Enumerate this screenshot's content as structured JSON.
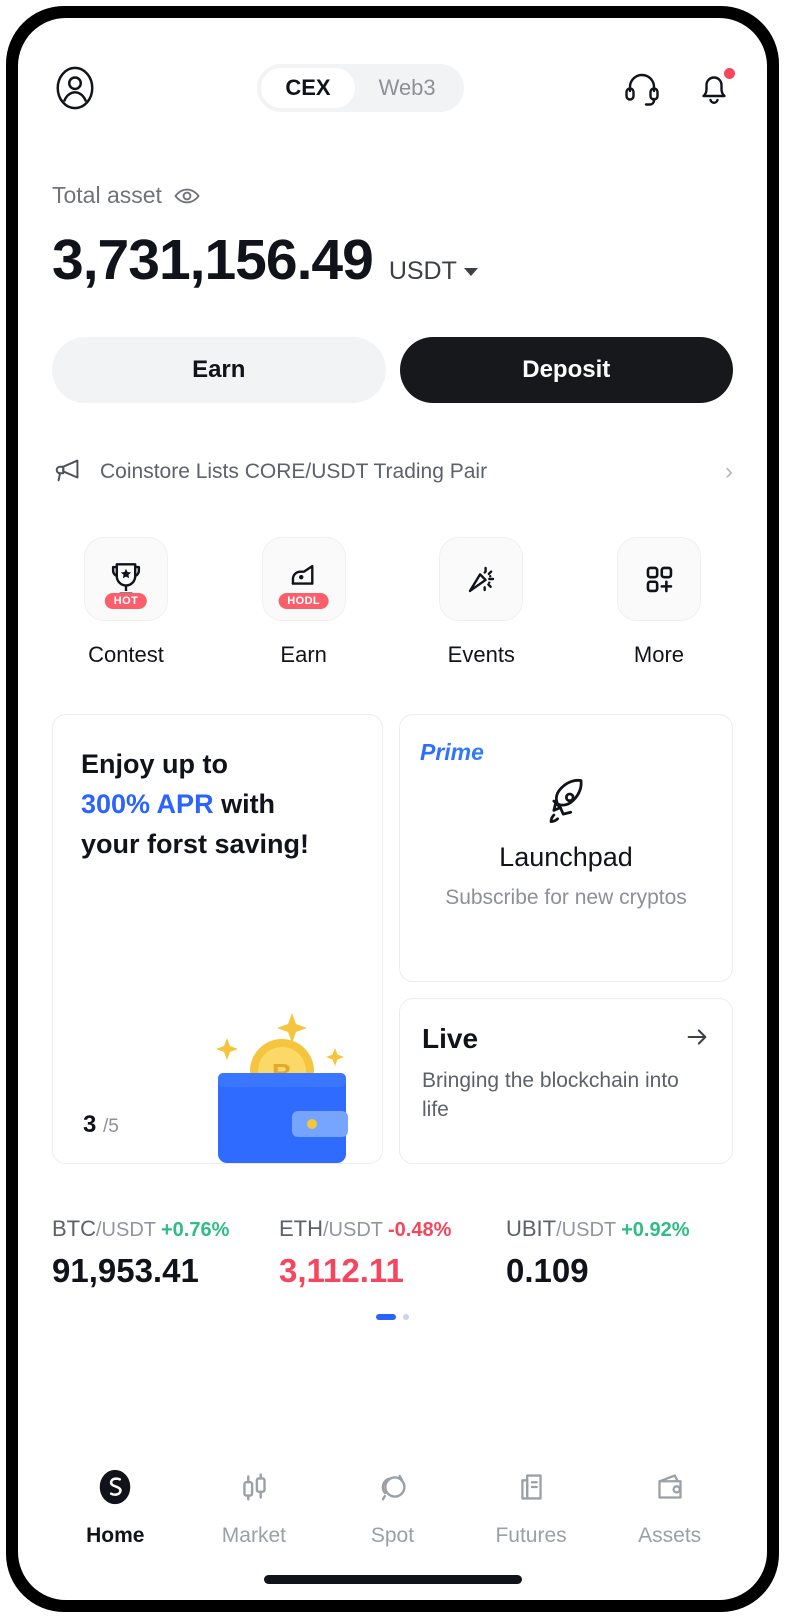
{
  "header": {
    "avatar_icon": "user-circle-icon",
    "tabs": [
      {
        "label": "CEX",
        "active": true
      },
      {
        "label": "Web3",
        "active": false
      }
    ],
    "support_icon": "headset-icon",
    "notification_icon": "bell-icon",
    "has_notification_dot": true
  },
  "balance": {
    "label": "Total asset",
    "visibility_icon": "eye-icon",
    "amount": "3,731,156.49",
    "currency": "USDT",
    "currency_caret_icon": "caret-down-icon"
  },
  "actions": {
    "earn_label": "Earn",
    "deposit_label": "Deposit"
  },
  "announcement": {
    "icon": "megaphone-icon",
    "text": "Coinstore Lists CORE/USDT Trading Pair",
    "chevron": "›"
  },
  "quick_actions": [
    {
      "label": "Contest",
      "icon": "trophy-icon",
      "badge": "HOT"
    },
    {
      "label": "Earn",
      "icon": "piggy-hand-icon",
      "badge": "HODL"
    },
    {
      "label": "Events",
      "icon": "party-popper-icon",
      "badge": ""
    },
    {
      "label": "More",
      "icon": "grid-plus-icon",
      "badge": ""
    }
  ],
  "promo_card": {
    "line1": "Enjoy up to",
    "accent": "300% APR",
    "line2_rest": " with",
    "line3": "your forst saving!",
    "count_current": "3",
    "count_total": "/5",
    "art_icon": "wallet-bitcoin-icon"
  },
  "launchpad_card": {
    "tag": "Prime",
    "icon": "rocket-icon",
    "title": "Launchpad",
    "subtitle": "Subscribe for new cryptos"
  },
  "live_card": {
    "title": "Live",
    "arrow_icon": "arrow-right-icon",
    "subtitle": "Bringing the blockchain into life"
  },
  "tickers": [
    {
      "base": "BTC",
      "quote": "/USDT",
      "change": "+0.76%",
      "direction": "up",
      "price": "91,953.41"
    },
    {
      "base": "ETH",
      "quote": "/USDT",
      "change": "-0.48%",
      "direction": "down",
      "price": "3,112.11"
    },
    {
      "base": "UBIT",
      "quote": "/USDT",
      "change": "+0.92%",
      "direction": "up",
      "price": "0.109"
    }
  ],
  "pagination": {
    "active_index": 0,
    "total": 2
  },
  "bottom_nav": [
    {
      "label": "Home",
      "icon": "coinstore-logo-icon",
      "active": true
    },
    {
      "label": "Market",
      "icon": "candlestick-icon",
      "active": false
    },
    {
      "label": "Spot",
      "icon": "swap-circles-icon",
      "active": false
    },
    {
      "label": "Futures",
      "icon": "document-chart-icon",
      "active": false
    },
    {
      "label": "Assets",
      "icon": "wallet-icon",
      "active": false
    }
  ],
  "colors": {
    "accent_blue": "#2a63ff",
    "up_green": "#2ebd85",
    "down_red": "#f6465d",
    "badge_red": "#fb5f6b",
    "dark": "#17181c"
  }
}
